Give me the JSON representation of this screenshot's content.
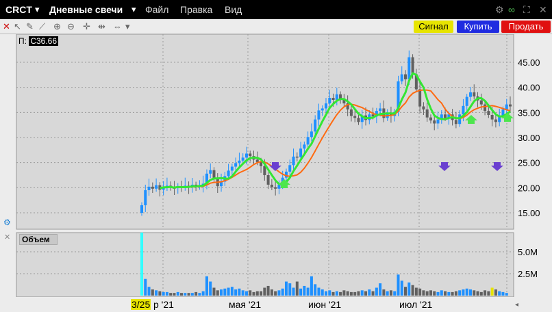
{
  "header": {
    "symbol": "CRCT",
    "chart_type": "Дневные свечи",
    "menu": [
      "Файл",
      "Правка",
      "Вид"
    ]
  },
  "toolbar": {
    "signal": "Сигнал",
    "buy": "Купить",
    "sell": "Продать"
  },
  "price_panel": {
    "last_label": "П:",
    "last_value": "C36.66",
    "y_ticks": [
      "45.00",
      "40.00",
      "35.00",
      "30.00",
      "25.00",
      "20.00",
      "15.00"
    ]
  },
  "volume_panel": {
    "title": "Объем",
    "y_ticks": [
      "5.0M",
      "2.5M"
    ]
  },
  "x_axis": {
    "labels": [
      "3/25",
      "р '21",
      "мая '21",
      "июн '21",
      "июл '21"
    ]
  },
  "colors": {
    "bull": "#1e90ff",
    "bear": "#606060",
    "ma_fast": "#33e633",
    "ma_slow": "#ff6a10",
    "highlight": "#e7e400"
  }
}
